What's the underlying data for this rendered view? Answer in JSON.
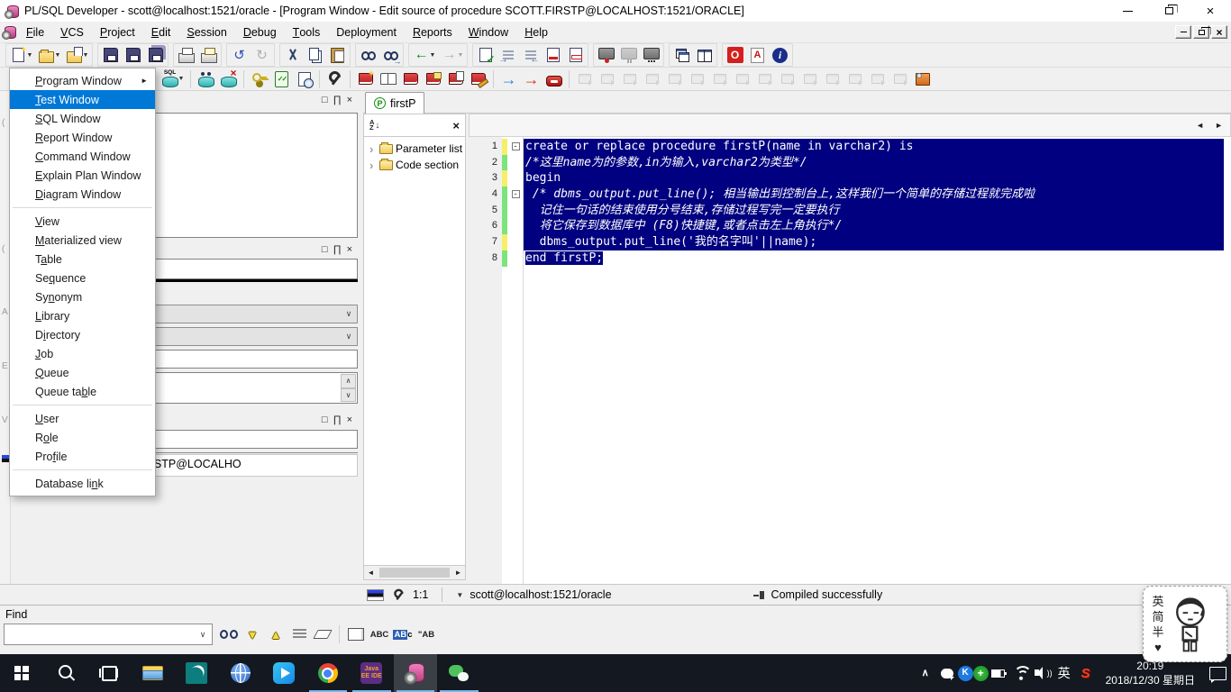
{
  "colors": {
    "accent": "#0078d7",
    "selection": "#000080",
    "taskbar_underline": "#76b9ed"
  },
  "window": {
    "title": "PL/SQL Developer - scott@localhost:1521/oracle - [Program Window - Edit source of procedure SCOTT.FIRSTP@LOCALHOST:1521/ORACLE]"
  },
  "menu_bar": {
    "items": [
      {
        "label": "File",
        "ul": 0
      },
      {
        "label": "VCS",
        "ul": 0
      },
      {
        "label": "Project",
        "ul": 0
      },
      {
        "label": "Edit",
        "ul": 0
      },
      {
        "label": "Session",
        "ul": 0
      },
      {
        "label": "Debug",
        "ul": 0
      },
      {
        "label": "Tools",
        "ul": 0
      },
      {
        "label": "Deployment",
        "ul": -1
      },
      {
        "label": "Reports",
        "ul": 0
      },
      {
        "label": "Window",
        "ul": 0
      },
      {
        "label": "Help",
        "ul": 0
      }
    ]
  },
  "new_menu": {
    "items": [
      {
        "label": "Program Window",
        "ul": 0,
        "submenu": true
      },
      {
        "label": "Test Window",
        "ul": 0,
        "selected": true
      },
      {
        "label": "SQL Window",
        "ul": 0
      },
      {
        "label": "Report Window",
        "ul": 0
      },
      {
        "label": "Command Window",
        "ul": 0
      },
      {
        "label": "Explain Plan Window",
        "ul": 0
      },
      {
        "label": "Diagram Window",
        "ul": 0
      },
      {
        "sep": true
      },
      {
        "label": "View",
        "ul": 0
      },
      {
        "label": "Materialized view",
        "ul": 0
      },
      {
        "label": "Table",
        "ul": 1
      },
      {
        "label": "Sequence",
        "ul": 2
      },
      {
        "label": "Synonym",
        "ul": 2
      },
      {
        "label": "Library",
        "ul": 0
      },
      {
        "label": "Directory",
        "ul": 1
      },
      {
        "label": "Job",
        "ul": 0
      },
      {
        "label": "Queue",
        "ul": 0
      },
      {
        "label": "Queue table",
        "ul": 8
      },
      {
        "sep": true
      },
      {
        "label": "User",
        "ul": 0
      },
      {
        "label": "Role",
        "ul": 1
      },
      {
        "label": "Profile",
        "ul": 3
      },
      {
        "sep": true
      },
      {
        "label": "Database link",
        "ul": 11
      }
    ]
  },
  "toolbar1": {
    "groups": [
      [
        {
          "n": "new-window-button",
          "c": "ic-newdoc",
          "dd": 1
        },
        {
          "n": "open-file-button",
          "c": "ic-openfolder",
          "dd": 1
        },
        {
          "n": "open-object-button",
          "c": "ic-opendoc",
          "dd": 1
        }
      ],
      [
        {
          "n": "save-button",
          "c": "ic-floppy"
        },
        {
          "n": "save-as-button",
          "c": "ic-floppy2"
        },
        {
          "n": "save-all-button",
          "c": "ic-floppyall"
        }
      ],
      [
        {
          "n": "print-button",
          "c": "ic-print"
        },
        {
          "n": "print-setup-button",
          "c": "ic-print2"
        }
      ],
      [
        {
          "n": "undo-button",
          "c": "ic-undo",
          "g": "↺"
        },
        {
          "n": "redo-button",
          "c": "ic-redo",
          "g": "↻",
          "dis": 1
        }
      ],
      [
        {
          "n": "cut-button",
          "c": "ic-cut"
        },
        {
          "n": "copy-button",
          "c": "ic-copy"
        },
        {
          "n": "paste-button",
          "c": "ic-paste"
        }
      ],
      [
        {
          "n": "find-button",
          "c": "ic-find"
        },
        {
          "n": "find-next-button",
          "c": "ic-findnext",
          "g": "→"
        }
      ],
      [
        {
          "n": "back-button",
          "c": "ic-back",
          "g": "←",
          "dd": 1
        },
        {
          "n": "forward-button",
          "c": "ic-forward",
          "g": "→",
          "dd": 1,
          "dis": 1
        }
      ],
      [
        {
          "n": "describe-button",
          "c": "ic-doccheck"
        },
        {
          "n": "indent-button",
          "c": "ic-indent"
        },
        {
          "n": "unindent-button",
          "c": "ic-unindent"
        },
        {
          "n": "comment-button",
          "c": "ic-comment"
        },
        {
          "n": "uncomment-button",
          "c": "ic-uncomment"
        }
      ],
      [
        {
          "n": "record-macro-button",
          "c": "ic-macro-rec"
        },
        {
          "n": "pause-macro-button",
          "c": "ic-macro-pause",
          "dis": 1
        },
        {
          "n": "play-macro-button",
          "c": "ic-macro-play"
        }
      ],
      [
        {
          "n": "cascade-windows-button",
          "c": "ic-cascade"
        },
        {
          "n": "tile-windows-button",
          "c": "ic-tile"
        }
      ],
      [
        {
          "n": "oracle-home-button",
          "c": "ic-oracle",
          "g": "O"
        },
        {
          "n": "pdf-export-button",
          "c": "ic-pdf",
          "g": "A"
        },
        {
          "n": "about-button",
          "c": "ic-info",
          "g": "i"
        }
      ]
    ]
  },
  "toolbar2": {
    "groups": [
      [
        {
          "n": "new-sql-window-button",
          "c": "ic-sqlcyl",
          "t": "SQL",
          "dd": 1
        }
      ],
      [
        {
          "n": "session-list-button",
          "c": "ic-cyl-find"
        },
        {
          "n": "rollback-button",
          "c": "ic-cyl-x",
          "g": "×"
        }
      ],
      [
        {
          "n": "grants-button",
          "c": "ic-keys"
        },
        {
          "n": "test-manager-button",
          "c": "ic-checklist"
        },
        {
          "n": "report-button",
          "c": "ic-reportclock"
        }
      ],
      [
        {
          "n": "preferences-button",
          "c": "ic-wrench"
        }
      ],
      [
        {
          "n": "new-program-button",
          "c": "ic-book-new"
        },
        {
          "n": "open-program-button",
          "c": "ic-book-open"
        },
        {
          "n": "save-program-button",
          "c": "ic-book"
        },
        {
          "n": "save-program-as-button",
          "c": "ic-book-note"
        },
        {
          "n": "compile-program-button",
          "c": "ic-book-copy"
        },
        {
          "n": "edit-program-button",
          "c": "ic-book-pencil"
        }
      ],
      [
        {
          "n": "execute-button",
          "c": "ic-arrow-blue",
          "g": "→"
        },
        {
          "n": "execute-debug-button",
          "c": "ic-arrow-red",
          "g": "→"
        },
        {
          "n": "break-button",
          "c": "ic-break"
        }
      ],
      [
        {
          "n": "start-debugger-button",
          "c": "ic-dbg",
          "dis": 1
        },
        {
          "n": "resume-debugger-button",
          "c": "ic-dbg",
          "dis": 1
        },
        {
          "n": "step-into-button",
          "c": "ic-dbg",
          "dis": 1
        },
        {
          "n": "step-over-button",
          "c": "ic-dbg",
          "dis": 1
        },
        {
          "n": "step-out-button",
          "c": "ic-dbg",
          "dis": 1
        },
        {
          "n": "run-to-exception-button",
          "c": "ic-dbg",
          "dis": 1
        },
        {
          "n": "toggle-breakpoint-button",
          "c": "ic-dbg",
          "dis": 1
        },
        {
          "n": "show-debug-info-button",
          "c": "ic-dbg",
          "dis": 1
        },
        {
          "n": "inspect-variable-button",
          "c": "ic-dbg",
          "dis": 1
        },
        {
          "n": "add-watch-button",
          "c": "ic-dbg",
          "dis": 1
        },
        {
          "n": "show-watches-button",
          "c": "ic-dbg",
          "dis": 1
        },
        {
          "n": "show-call-stack-button",
          "c": "ic-dbg",
          "dis": 1
        },
        {
          "n": "show-output-button",
          "c": "ic-dbg",
          "dis": 1
        },
        {
          "n": "show-events-button",
          "c": "ic-dbg",
          "dis": 1
        },
        {
          "n": "stop-debugger-button",
          "c": "ic-dbg",
          "dis": 1
        },
        {
          "n": "debug-settings-button",
          "c": "ic-testset"
        }
      ]
    ]
  },
  "editor": {
    "tab": {
      "label": "firstP",
      "icon": "P"
    },
    "tree": {
      "items": [
        {
          "label": "Parameter list"
        },
        {
          "label": "Code section"
        }
      ]
    },
    "code": {
      "lines": [
        {
          "num": 1,
          "fold": true,
          "bar": "y",
          "sel": "full",
          "text": "create or replace procedure firstP(name in varchar2) is"
        },
        {
          "num": 2,
          "fold": false,
          "bar": "g",
          "sel": "full",
          "italic": true,
          "text": "/*这里name为的参数,in为输入,varchar2为类型*/"
        },
        {
          "num": 3,
          "fold": false,
          "bar": "y",
          "sel": "full",
          "text": "begin"
        },
        {
          "num": 4,
          "fold": true,
          "bar": "g",
          "sel": "full",
          "italic": true,
          "text": " /* dbms_output.put_line(); 相当输出到控制台上,这样我们一个简单的存储过程就完成啦"
        },
        {
          "num": 5,
          "fold": false,
          "bar": "g",
          "sel": "full",
          "italic": true,
          "text": "  记住一句话的结束使用分号结束,存储过程写完一定要执行"
        },
        {
          "num": 6,
          "fold": false,
          "bar": "g",
          "sel": "full",
          "italic": true,
          "text": "  将它保存到数据库中 (F8)快捷键,或者点击左上角执行*/"
        },
        {
          "num": 7,
          "fold": false,
          "bar": "y",
          "sel": "full",
          "text": "  dbms_output.put_line('我的名字叫'||name);"
        },
        {
          "num": 8,
          "fold": false,
          "bar": "g",
          "sel": "text",
          "text": "end firstP;"
        }
      ]
    }
  },
  "left_panels": {
    "window_list_text": "ce of procedure SCOTT.FIRSTP@LOCALHO"
  },
  "status_bar": {
    "position": "1:1",
    "connection": "scott@localhost:1521/oracle",
    "message": "Compiled successfully"
  },
  "find_panel": {
    "label": "Find",
    "input_value": "",
    "buttons": [
      {
        "n": "find-button",
        "c": "fi-binoc"
      },
      {
        "n": "find-next-button",
        "c": "fi-down",
        "g": "▼"
      },
      {
        "n": "find-previous-button",
        "c": "fi-up",
        "g": "▲"
      },
      {
        "n": "mark-all-button",
        "c": "fi-mark"
      },
      {
        "n": "clear-highlight-button",
        "c": "fi-eraser"
      },
      {
        "sep": true
      },
      {
        "n": "selection-only-button",
        "c": "fi-box"
      },
      {
        "n": "whole-word-button",
        "c": "fi-abc",
        "t": "ABC"
      },
      {
        "n": "case-sensitive-button",
        "c": "fi-abc2",
        "t1": "AB",
        "t2": "c"
      },
      {
        "n": "search-in-strings-button",
        "c": "fi-abq",
        "t": "\"AB"
      }
    ]
  },
  "taskbar": {
    "apps": [
      {
        "n": "start-button",
        "c": "tb-start"
      },
      {
        "n": "search-button",
        "c": "tb-search"
      },
      {
        "n": "task-view-button",
        "c": "tb-taskview"
      },
      {
        "n": "file-explorer-button",
        "c": "tb-explorer"
      },
      {
        "n": "notes-app-button",
        "c": "tb-teal"
      },
      {
        "n": "browser-button",
        "c": "tb-globe"
      },
      {
        "n": "video-player-button",
        "c": "tb-play"
      },
      {
        "n": "chrome-button",
        "c": "tb-chrome",
        "run": 1
      },
      {
        "n": "java-ee-ide-button",
        "c": "tb-javaee",
        "t": "Java EE IDE",
        "run": 1
      },
      {
        "n": "plsql-developer-button",
        "c": "tb-plsql",
        "run": 1,
        "active": 1
      },
      {
        "n": "wechat-button",
        "c": "tb-wechat",
        "run": 1
      }
    ],
    "tray": [
      {
        "n": "tray-expand-button",
        "c": "tr-chevron",
        "g": "∧"
      },
      {
        "n": "wechat-tray-icon",
        "c": "tr-wechat"
      },
      {
        "n": "k-app-tray-icon",
        "c": "tr-k",
        "g": "K"
      },
      {
        "n": "antivirus-tray-icon",
        "c": "tr-plus",
        "g": "+"
      },
      {
        "n": "battery-icon",
        "c": "tr-battery"
      },
      {
        "n": "wifi-icon",
        "c": "tr-wifi"
      },
      {
        "n": "volume-icon",
        "c": "tr-volume",
        "g": "))"
      },
      {
        "n": "ime-language-indicator",
        "c": "tr-ime",
        "g": "英"
      },
      {
        "n": "sogou-tray-icon",
        "c": "tr-sogou",
        "g": "S"
      }
    ],
    "clock": {
      "time": "20:19",
      "date": "2018/12/30 星期日"
    }
  },
  "ime_popup": {
    "chars": [
      "英",
      "简",
      "半",
      "♥"
    ]
  }
}
